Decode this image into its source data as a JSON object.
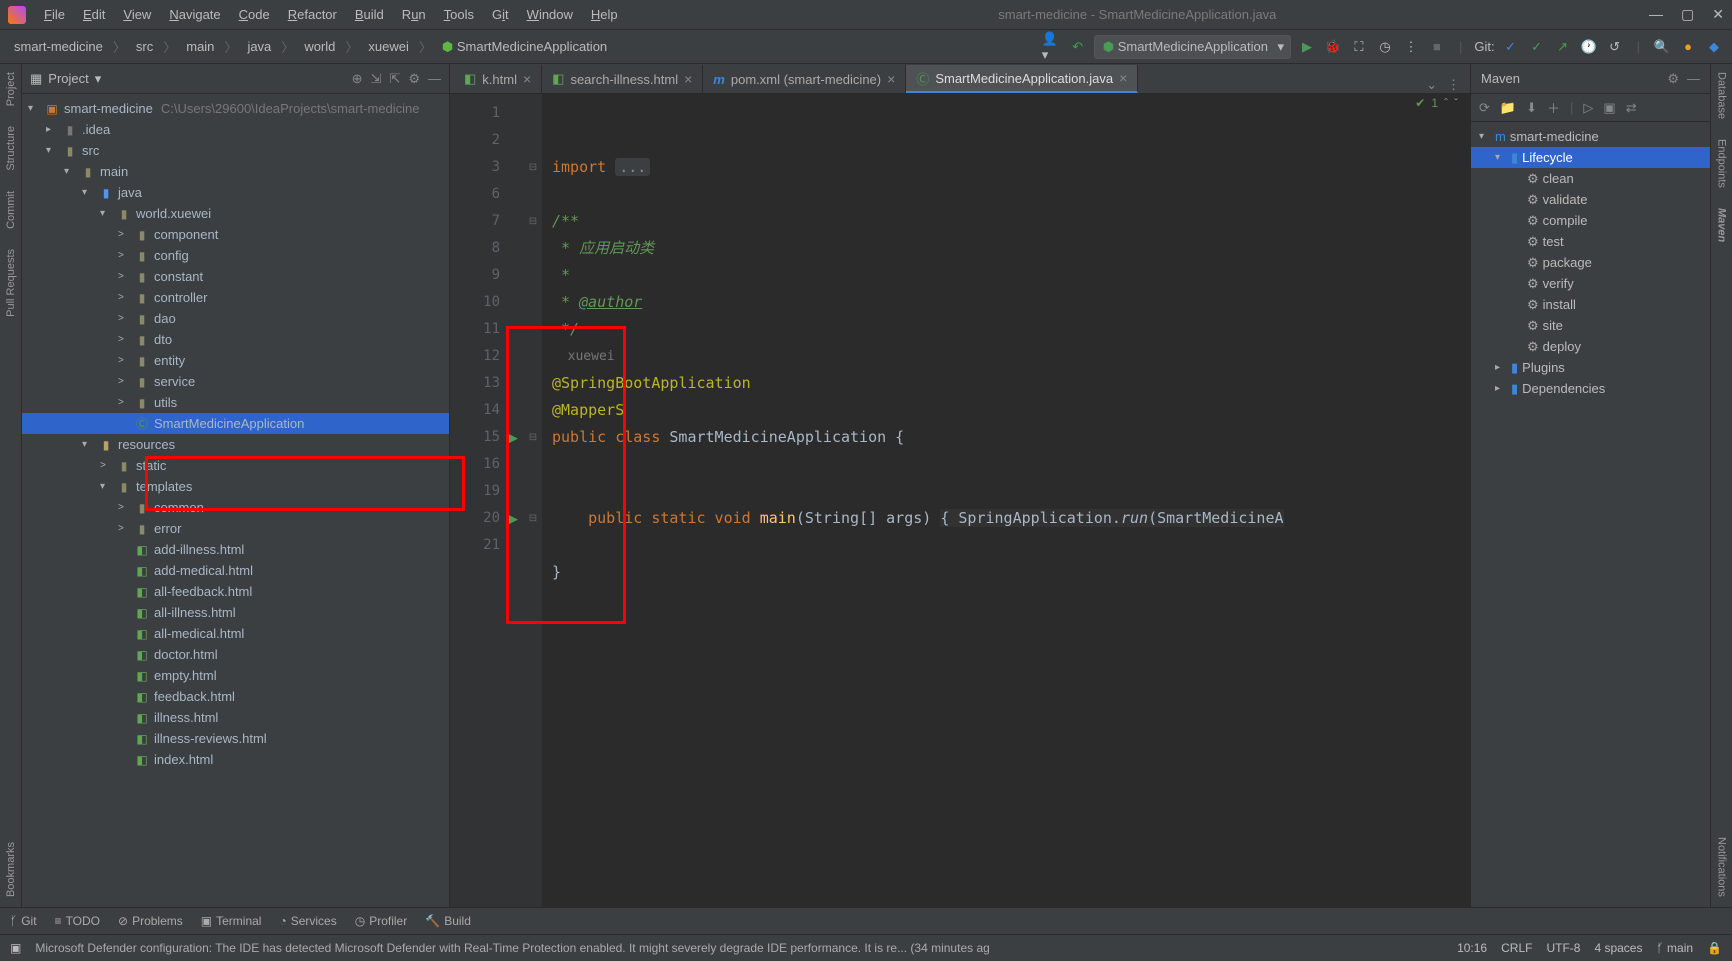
{
  "title": "smart-medicine - SmartMedicineApplication.java",
  "menus": [
    "File",
    "Edit",
    "View",
    "Navigate",
    "Code",
    "Refactor",
    "Build",
    "Run",
    "Tools",
    "Git",
    "Window",
    "Help"
  ],
  "breadcrumbs": [
    "smart-medicine",
    "src",
    "main",
    "java",
    "world",
    "xuewei",
    "SmartMedicineApplication"
  ],
  "run_config": "SmartMedicineApplication",
  "git_label": "Git:",
  "project": {
    "panel_title": "Project",
    "root": "smart-medicine",
    "root_path": "C:\\Users\\29600\\IdeaProjects\\smart-medicine",
    "tree": [
      {
        "d": 1,
        "t": ".idea",
        "exp": false,
        "kind": "dir-gray"
      },
      {
        "d": 1,
        "t": "src",
        "exp": true,
        "kind": "dir"
      },
      {
        "d": 2,
        "t": "main",
        "exp": true,
        "kind": "dir"
      },
      {
        "d": 3,
        "t": "java",
        "exp": true,
        "kind": "dir-blue"
      },
      {
        "d": 4,
        "t": "world.xuewei",
        "exp": true,
        "kind": "pkg"
      },
      {
        "d": 5,
        "t": "component",
        "exp": false,
        "kind": "pkg",
        "arrow": ">"
      },
      {
        "d": 5,
        "t": "config",
        "exp": false,
        "kind": "pkg",
        "arrow": ">"
      },
      {
        "d": 5,
        "t": "constant",
        "exp": false,
        "kind": "pkg",
        "arrow": ">"
      },
      {
        "d": 5,
        "t": "controller",
        "exp": false,
        "kind": "pkg",
        "arrow": ">"
      },
      {
        "d": 5,
        "t": "dao",
        "exp": false,
        "kind": "pkg",
        "arrow": ">"
      },
      {
        "d": 5,
        "t": "dto",
        "exp": false,
        "kind": "pkg",
        "arrow": ">"
      },
      {
        "d": 5,
        "t": "entity",
        "exp": false,
        "kind": "pkg",
        "arrow": ">"
      },
      {
        "d": 5,
        "t": "service",
        "exp": false,
        "kind": "pkg",
        "arrow": ">"
      },
      {
        "d": 5,
        "t": "utils",
        "exp": false,
        "kind": "pkg",
        "arrow": ">"
      },
      {
        "d": 5,
        "t": "SmartMedicineApplication",
        "kind": "class",
        "sel": true
      },
      {
        "d": 3,
        "t": "resources",
        "exp": true,
        "kind": "dir-res"
      },
      {
        "d": 4,
        "t": "static",
        "exp": false,
        "kind": "dir",
        "arrow": ">"
      },
      {
        "d": 4,
        "t": "templates",
        "exp": true,
        "kind": "dir"
      },
      {
        "d": 5,
        "t": "common",
        "exp": false,
        "kind": "dir",
        "arrow": ">"
      },
      {
        "d": 5,
        "t": "error",
        "exp": false,
        "kind": "dir",
        "arrow": ">"
      },
      {
        "d": 5,
        "t": "add-illness.html",
        "kind": "html"
      },
      {
        "d": 5,
        "t": "add-medical.html",
        "kind": "html"
      },
      {
        "d": 5,
        "t": "all-feedback.html",
        "kind": "html"
      },
      {
        "d": 5,
        "t": "all-illness.html",
        "kind": "html"
      },
      {
        "d": 5,
        "t": "all-medical.html",
        "kind": "html"
      },
      {
        "d": 5,
        "t": "doctor.html",
        "kind": "html"
      },
      {
        "d": 5,
        "t": "empty.html",
        "kind": "html"
      },
      {
        "d": 5,
        "t": "feedback.html",
        "kind": "html"
      },
      {
        "d": 5,
        "t": "illness.html",
        "kind": "html"
      },
      {
        "d": 5,
        "t": "illness-reviews.html",
        "kind": "html"
      },
      {
        "d": 5,
        "t": "index.html",
        "kind": "html"
      }
    ]
  },
  "tabs": [
    {
      "label": "k.html",
      "icon": "html"
    },
    {
      "label": "search-illness.html",
      "icon": "html"
    },
    {
      "label": "pom.xml (smart-medicine)",
      "icon": "maven"
    },
    {
      "label": "SmartMedicineApplication.java",
      "icon": "class",
      "active": true
    }
  ],
  "code_lines": [
    {
      "n": 1
    },
    {
      "n": 2
    },
    {
      "n": 3,
      "html": "<span class='kw'>import</span> <span class='fold-dots'>...</span>"
    },
    {
      "n": 6
    },
    {
      "n": 7,
      "html": "<span class='jd'>/**</span>"
    },
    {
      "n": 8,
      "html": "<span class='jd'> * 应用启动类</span>"
    },
    {
      "n": 9,
      "html": "<span class='jd'> *</span>"
    },
    {
      "n": 10,
      "html": "<span class='jd'> * <span class='jdtag'>@author</span></span>"
    },
    {
      "n": 11,
      "html": "<span class='jd'> */</span>"
    },
    {
      "n": "",
      "html": "  <span class='dim'>xuewei</span>",
      "inlay": true
    },
    {
      "n": 12,
      "html": "<span class='ann'>@SpringBootApplication</span>"
    },
    {
      "n": 13,
      "html": "<span class='ann'>@MapperS</span>"
    },
    {
      "n": 14,
      "html": "<span class='kw'>public class</span> <span class='type'>SmartMedicineApplication</span> {",
      "run": true
    },
    {
      "n": 15
    },
    {
      "n": "",
      "html": ""
    },
    {
      "n": 16,
      "html": "    <span class='kw'>public static void</span> <span class='method'>main</span>(<span class='type'>String</span>[] args) <span class='hl-block'>{ SpringApplication.<span style='font-style:italic'>run</span>(SmartMedicineA</span>",
      "run": true
    },
    {
      "n": 19
    },
    {
      "n": 20,
      "html": "}"
    },
    {
      "n": 21
    }
  ],
  "editor_status": {
    "warnings": "1"
  },
  "maven": {
    "title": "Maven",
    "root": "smart-medicine",
    "lifecycle_label": "Lifecycle",
    "lifecycle": [
      "clean",
      "validate",
      "compile",
      "test",
      "package",
      "verify",
      "install",
      "site",
      "deploy"
    ],
    "plugins": "Plugins",
    "dependencies": "Dependencies"
  },
  "left_tabs": [
    "Project",
    "Structure",
    "Commit",
    "Pull Requests",
    "Bookmarks"
  ],
  "right_tabs": [
    "Database",
    "Endpoints",
    "Maven",
    "Notifications"
  ],
  "bottom_tools": [
    "Git",
    "TODO",
    "Problems",
    "Terminal",
    "Services",
    "Profiler",
    "Build"
  ],
  "status": {
    "msg": "Microsoft Defender configuration: The IDE has detected Microsoft Defender with Real-Time Protection enabled. It might severely degrade IDE performance. It is re... (34 minutes ag",
    "pos": "10:16",
    "eol": "CRLF",
    "enc": "UTF-8",
    "indent": "4 spaces",
    "branch": "main"
  }
}
